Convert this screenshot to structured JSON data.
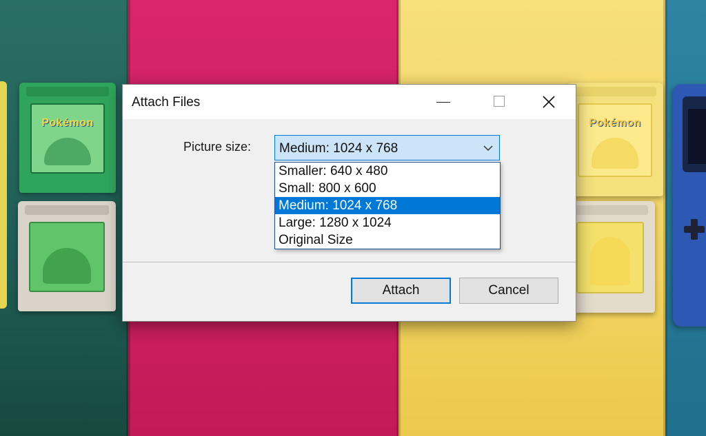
{
  "dialog": {
    "title": "Attach Files",
    "picture_size_label": "Picture size:",
    "selected_size": "Medium: 1024 x 768",
    "options": [
      "Smaller: 640 x 480",
      "Small: 800 x 600",
      "Medium: 1024 x 768",
      "Large: 1280 x 1024",
      "Original Size"
    ],
    "highlighted_option_index": 2,
    "buttons": {
      "attach": "Attach",
      "cancel": "Cancel"
    }
  },
  "background": {
    "carts": {
      "top_left": "Pokémon",
      "top_right": "Pokémon"
    }
  },
  "colors": {
    "accent": "#0078d7",
    "combo_bg": "#cce4f7",
    "dialog_bg": "#f0f0f0",
    "stripe_teal": "#1f5d54",
    "stripe_pink": "#cf1f62",
    "stripe_yellow": "#f2d461",
    "stripe_blue": "#206f8d"
  },
  "icons": {
    "minimize": "minimize-icon",
    "maximize": "maximize-icon",
    "close": "close-icon",
    "dropdown": "chevron-down-icon"
  }
}
